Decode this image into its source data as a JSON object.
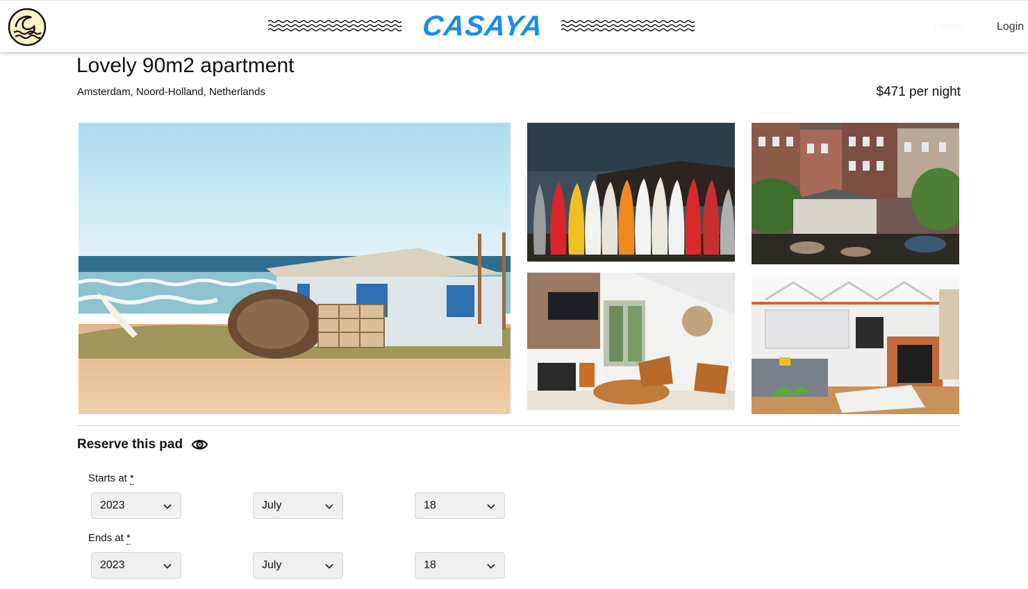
{
  "header": {
    "brand": "CASAYA",
    "nav": {
      "home": "Home",
      "login": "Login"
    },
    "logo_icon": "wave-logo-icon",
    "brand_color": "#1a8cf0"
  },
  "listing": {
    "title": "Lovely 90m2 apartment",
    "location": "Amsterdam, Noord-Holland, Netherlands",
    "price": "$471 per night"
  },
  "gallery": {
    "photos": [
      {
        "icon": "beach-hut-photo"
      },
      {
        "icon": "surfboards-photo"
      },
      {
        "icon": "amsterdam-canal-houses-photo"
      },
      {
        "icon": "living-room-fireplace-photo"
      },
      {
        "icon": "loft-living-room-photo"
      }
    ]
  },
  "reserve": {
    "title": "Reserve this pad",
    "title_icon": "eye-icon",
    "start": {
      "label": "Starts at",
      "required": "*",
      "year": "2023",
      "month": "July",
      "day": "18"
    },
    "end": {
      "label": "Ends at",
      "required": "*",
      "year": "2023",
      "month": "July",
      "day": "18"
    }
  }
}
